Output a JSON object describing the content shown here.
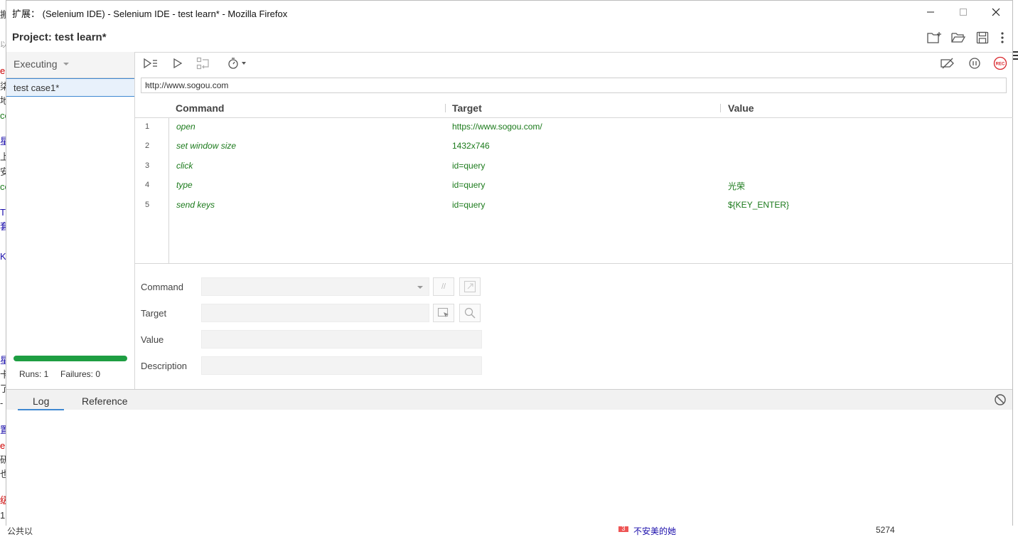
{
  "window": {
    "title": "扩展： (Selenium IDE) - Selenium IDE - test learn* - Mozilla Firefox"
  },
  "project": {
    "label": "Project:",
    "name": "test learn*"
  },
  "sidebar": {
    "mode": "Executing",
    "test_case": "test case1*",
    "progress": 1.0,
    "runs": "Runs: 1",
    "failures": "Failures: 0"
  },
  "url_bar": {
    "value": "http://www.sogou.com"
  },
  "table": {
    "headers": [
      "Command",
      "Target",
      "Value"
    ],
    "rows": [
      {
        "num": "1",
        "command": "open",
        "target": "https://www.sogou.com/",
        "value": ""
      },
      {
        "num": "2",
        "command": "set window size",
        "target": "1432x746",
        "value": ""
      },
      {
        "num": "3",
        "command": "click",
        "target": "id=query",
        "value": ""
      },
      {
        "num": "4",
        "command": "type",
        "target": "id=query",
        "value": "光荣"
      },
      {
        "num": "5",
        "command": "send keys",
        "target": "id=query",
        "value": "${KEY_ENTER}"
      }
    ]
  },
  "editor": {
    "command_label": "Command",
    "target_label": "Target",
    "value_label": "Value",
    "description_label": "Description",
    "comment_glyph": "//"
  },
  "log_panel": {
    "tabs": [
      "Log",
      "Reference"
    ]
  },
  "background": {
    "left_fragments": [
      "搬",
      "以",
      "e",
      "柒",
      "地",
      "co",
      "星",
      "上",
      "安",
      "co",
      "Tu",
      "套",
      "K",
      "星",
      "卡",
      "了",
      "-",
      "置",
      "en",
      "研",
      "也",
      "级",
      "1"
    ],
    "bottom_text_1": "公共以",
    "bottom_badge": "3",
    "bottom_text_2": "不安美的她",
    "bottom_text_3": "5274"
  },
  "colors": {
    "accent": "#3f88d2",
    "progress": "#1e9e42",
    "command_text": "#1b7a1b",
    "record": "#d9262c"
  }
}
